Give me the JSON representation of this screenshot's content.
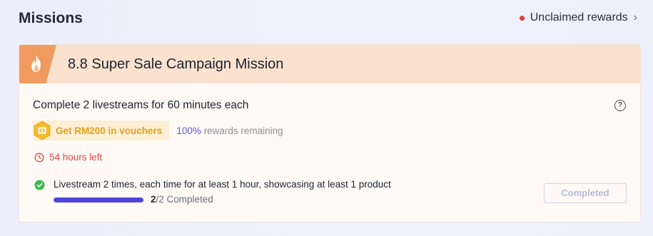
{
  "header": {
    "title": "Missions",
    "unclaimed_label": "Unclaimed rewards",
    "unclaimed_icon": "chevron-right-icon"
  },
  "mission": {
    "title": "8.8 Super Sale Campaign Mission",
    "icon": "flame-icon",
    "task_title": "Complete 2 livestreams for 60 minutes each",
    "reward_label": "Get RM200 in vouchers",
    "reward_icon": "voucher-badge-icon",
    "remaining_pct": "100%",
    "remaining_label": "rewards remaining",
    "time_left": "54 hours left",
    "requirement": "Livestream 2 times, each time for at least 1 hour, showcasing at least 1 product",
    "progress_done": "2",
    "progress_total": "/2 Completed",
    "progress_fraction": 1.0,
    "status_button": "Completed"
  },
  "colors": {
    "accent": "#4f46d9",
    "warning": "#e04848",
    "reward": "#e3a21a",
    "header_band": "#fbe2cf",
    "flame_tab": "#f09a5f",
    "success": "#3fb950"
  }
}
